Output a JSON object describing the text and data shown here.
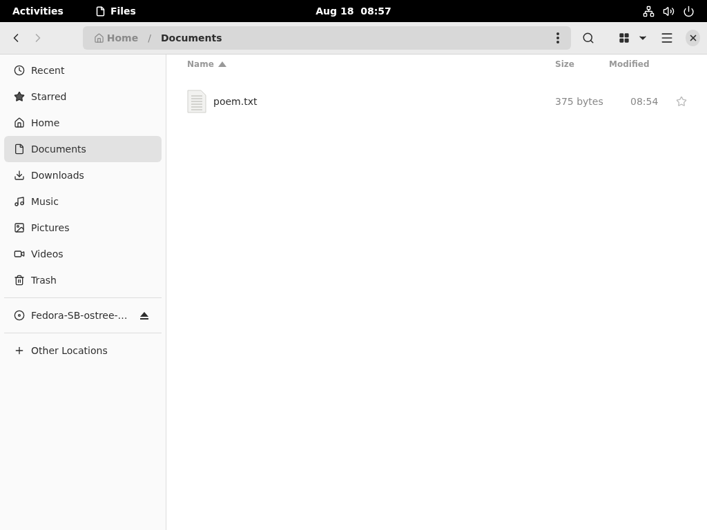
{
  "top_bar": {
    "activities": "Activities",
    "app_name": "Files",
    "clock": "Aug 18  08:57"
  },
  "toolbar": {
    "path": [
      {
        "label": "Home",
        "selected": false
      },
      {
        "label": "Documents",
        "selected": true
      }
    ],
    "separator": "/"
  },
  "sidebar": {
    "places": [
      {
        "label": "Recent",
        "selected": false
      },
      {
        "label": "Starred",
        "selected": false
      },
      {
        "label": "Home",
        "selected": false
      },
      {
        "label": "Documents",
        "selected": true
      },
      {
        "label": "Downloads",
        "selected": false
      },
      {
        "label": "Music",
        "selected": false
      },
      {
        "label": "Pictures",
        "selected": false
      },
      {
        "label": "Videos",
        "selected": false
      },
      {
        "label": "Trash",
        "selected": false
      }
    ],
    "devices": [
      {
        "label": "Fedora-SB-ostree-…",
        "selected": false
      }
    ],
    "other": [
      {
        "label": "Other Locations",
        "selected": false
      }
    ]
  },
  "table": {
    "columns": [
      {
        "label": "Name",
        "sorted": true
      },
      {
        "label": "Size",
        "sorted": false
      },
      {
        "label": "Modified",
        "sorted": false
      }
    ],
    "rows": [
      {
        "name": "poem.txt",
        "size": "375 bytes",
        "modified": "08:54",
        "starred": false
      }
    ]
  }
}
